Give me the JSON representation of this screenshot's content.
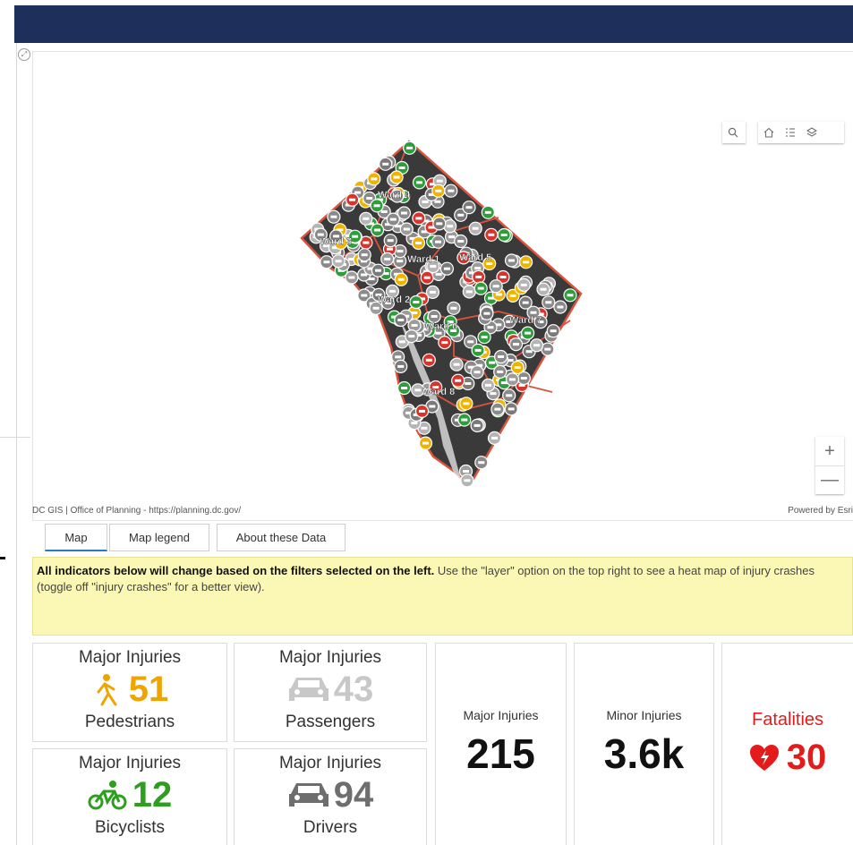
{
  "map": {
    "ward_labels": [
      "Ward 4",
      "Ward 3",
      "Ward 1",
      "Ward 5",
      "Ward 2",
      "Ward 6",
      "Ward 7",
      "Ward 8"
    ],
    "attribution_left": "DC GIS | Office of Planning - https://planning.dc.gov/",
    "attribution_right": "Powered by Esri",
    "zoom_in": "+",
    "zoom_out": "—",
    "tools": [
      "search-icon",
      "home-icon",
      "legend-list-icon",
      "layers-icon"
    ]
  },
  "tabs": [
    {
      "label": "Map",
      "active": true
    },
    {
      "label": "Map legend",
      "active": false
    },
    {
      "label": "About these Data",
      "active": false
    }
  ],
  "notice": {
    "bold": "All indicators below will change based on the filters selected on the left.",
    "text": " Use the \"layer\" option on the top right to see a heat map of injury crashes (toggle off \"injury crashes\" for a better view)."
  },
  "indicators": {
    "pedestrians": {
      "title": "Major Injuries",
      "value": "51",
      "label": "Pedestrians",
      "color": "#f0a400",
      "icon": "pedestrian-icon"
    },
    "passengers": {
      "title": "Major Injuries",
      "value": "43",
      "label": "Passengers",
      "color": "#c8c8c8",
      "icon": "car-icon"
    },
    "bicyclists": {
      "title": "Major Injuries",
      "value": "12",
      "label": "Bicyclists",
      "color": "#2e9e1f",
      "icon": "bicycle-icon"
    },
    "drivers": {
      "title": "Major Injuries",
      "value": "94",
      "label": "Drivers",
      "color": "#6e6e6e",
      "icon": "car-icon"
    },
    "major_total": {
      "title": "Major Injuries",
      "value": "215"
    },
    "minor_total": {
      "title": "Minor Injuries",
      "value": "3.6k"
    },
    "fatalities": {
      "title": "Fatalities",
      "value": "30",
      "color": "#e31b1b",
      "icon": "heart-icon"
    }
  }
}
